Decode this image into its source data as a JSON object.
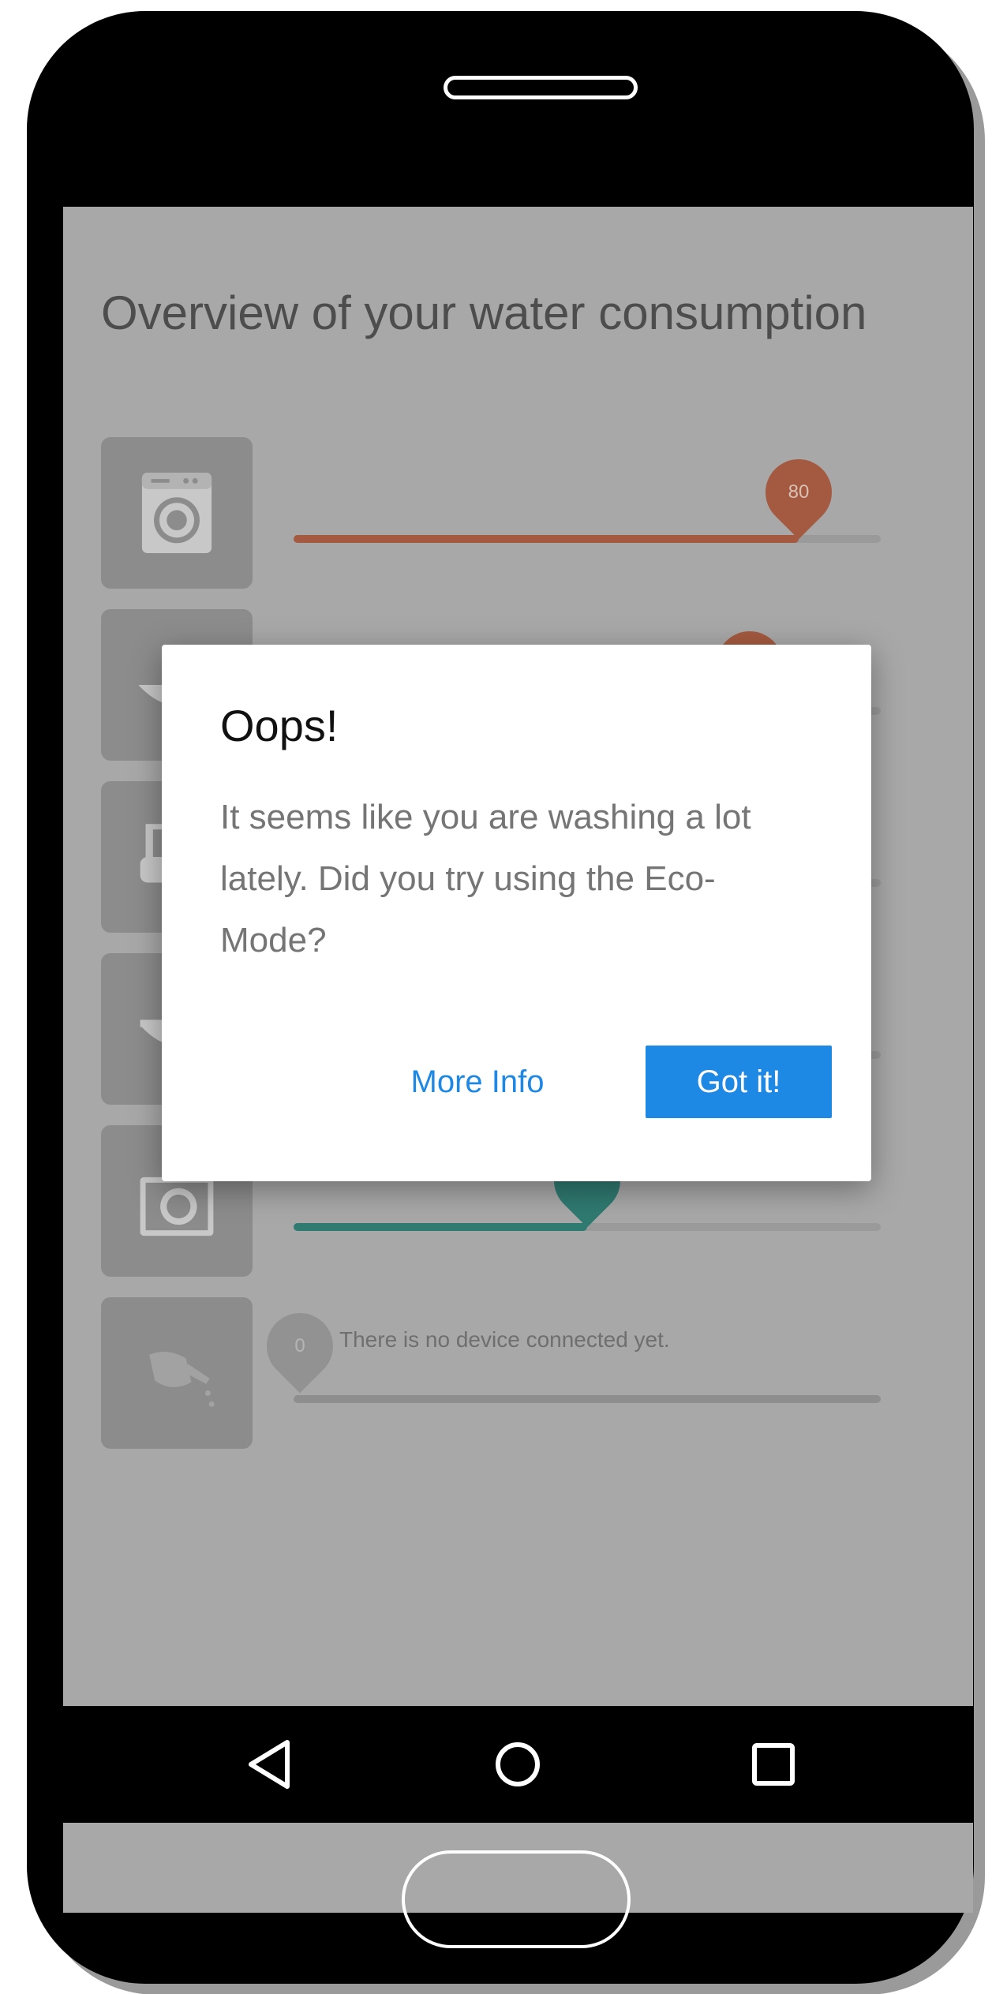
{
  "screen": {
    "title": "Overview of your water consumption"
  },
  "devices": [
    {
      "icon": "washing-machine-icon",
      "value": 80,
      "value_label": "80",
      "level": 0.8,
      "color": "#a45a40"
    },
    {
      "icon": "sink-icon",
      "value_label": "",
      "color": "#a45a40"
    },
    {
      "icon": "bathtub-icon",
      "value_label": "",
      "color": "#a45a40"
    },
    {
      "icon": "toilet-icon",
      "value_label": "",
      "color": "#a45a40"
    },
    {
      "icon": "dishwasher-icon",
      "value_label": "",
      "level": 0.46,
      "color": "#2f7a71"
    },
    {
      "icon": "watering-can-icon",
      "value": 0,
      "value_label": "0",
      "level": 0,
      "color": "#8e8e8e",
      "status": "There is no device connected yet."
    }
  ],
  "dialog": {
    "title": "Oops!",
    "message": "It seems like you are washing a lot lately. Did you try using the Eco-Mode?",
    "secondary_button": "More Info",
    "primary_button": "Got it!"
  },
  "colors": {
    "accent_blue": "#1e88e5",
    "warning_pin": "#a45a40",
    "ok_pin": "#2f7a71"
  },
  "navigation": {
    "buttons": [
      "back-icon",
      "home-icon",
      "recents-icon"
    ]
  }
}
